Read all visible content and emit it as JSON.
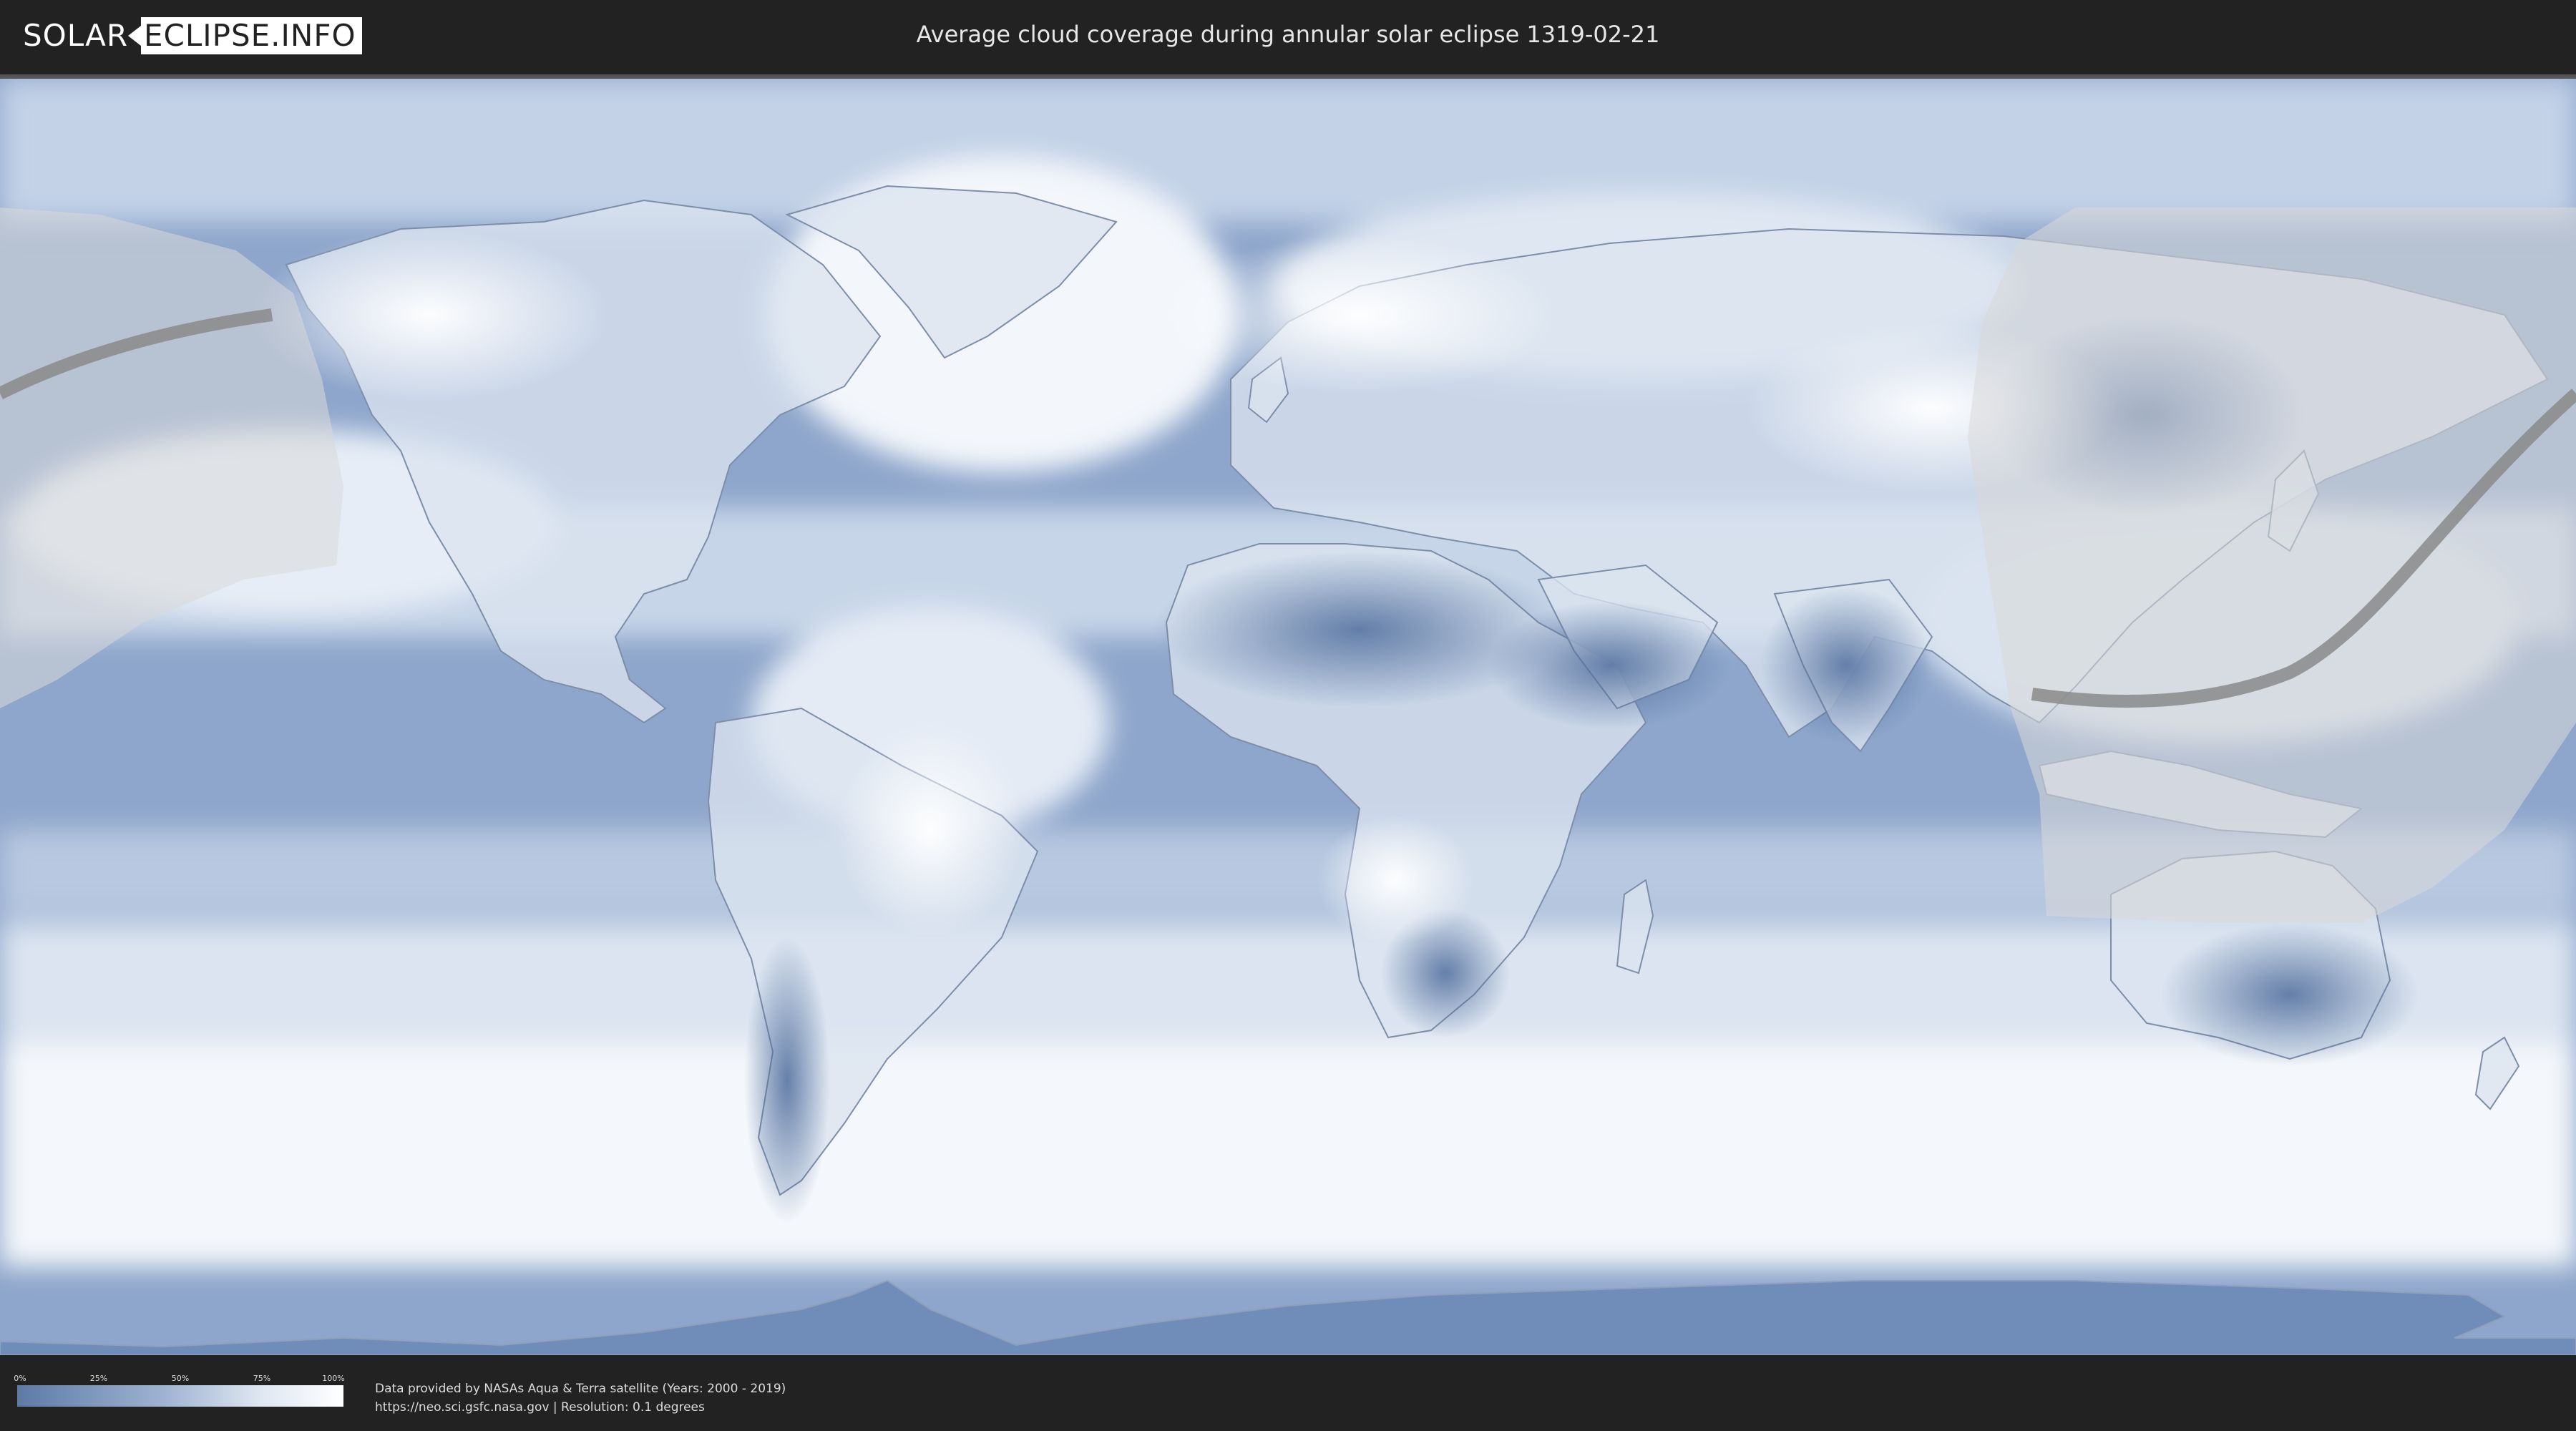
{
  "header": {
    "logo_part1": "SOLAR",
    "logo_part2": "ECLIPSE.INFO",
    "title": "Average cloud coverage during annular solar eclipse 1319-02-21"
  },
  "map": {
    "kind": "world cloud coverage map",
    "colors": {
      "ocean_cloud_low": "#6e8bb8",
      "cloud_high": "#ffffff",
      "eclipse_overlay": "#d8d8d8",
      "eclipse_path": "#8a8a8a",
      "borders": "#7d8ea8"
    }
  },
  "legend": {
    "ticks": [
      "0%",
      "25%",
      "50%",
      "75%",
      "100%"
    ]
  },
  "footer": {
    "credit_line1": "Data provided by NASAs Aqua & Terra satellite (Years: 2000 - 2019)",
    "credit_line2": "https://neo.sci.gsfc.nasa.gov | Resolution: 0.1 degrees"
  }
}
